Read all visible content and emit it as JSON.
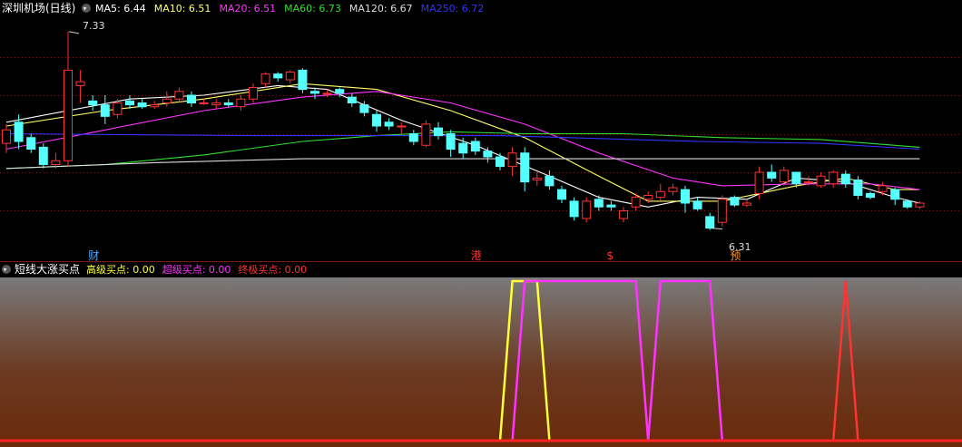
{
  "header": {
    "title": "深圳机场(日线)",
    "ma": [
      {
        "label": "MA5:",
        "value": "6.44",
        "color": "#ffffff"
      },
      {
        "label": "MA10:",
        "value": "6.51",
        "color": "#ffff66"
      },
      {
        "label": "MA20:",
        "value": "6.51",
        "color": "#ff33ff"
      },
      {
        "label": "MA60:",
        "value": "6.73",
        "color": "#33dd33"
      },
      {
        "label": "MA120:",
        "value": "6.67",
        "color": "#dddddd"
      },
      {
        "label": "MA250:",
        "value": "6.72",
        "color": "#3333ff"
      }
    ]
  },
  "indicator": {
    "title": "短线大涨买点",
    "items": [
      {
        "label": "高级买点:",
        "value": "0.00",
        "color": "#ffff33"
      },
      {
        "label": "超级买点:",
        "value": "0.00",
        "color": "#ff33ff"
      },
      {
        "label": "终极买点:",
        "value": "0.00",
        "color": "#ff3333"
      }
    ]
  },
  "annotations": {
    "high": "7.33",
    "low": "6.31",
    "markers": [
      "财",
      "港",
      "$",
      "预"
    ]
  },
  "colors": {
    "up": "#ff3333",
    "down": "#54ffff",
    "background": "#000000",
    "grid": "#7a1a1a"
  },
  "chart_data": {
    "type": "candlestick",
    "ylim": [
      6.2,
      7.4
    ],
    "candles": [
      [
        6.75,
        6.82,
        6.7,
        6.85
      ],
      [
        6.86,
        6.76,
        6.72,
        6.9
      ],
      [
        6.78,
        6.72,
        6.7,
        6.8
      ],
      [
        6.73,
        6.64,
        6.62,
        6.75
      ],
      [
        6.64,
        6.66,
        6.62,
        6.7
      ],
      [
        6.66,
        7.13,
        6.63,
        7.33
      ],
      [
        7.05,
        7.07,
        6.96,
        7.13
      ],
      [
        6.97,
        6.95,
        6.92,
        7.0
      ],
      [
        6.95,
        6.89,
        6.85,
        7.0
      ],
      [
        6.9,
        6.96,
        6.88,
        6.98
      ],
      [
        6.97,
        6.95,
        6.93,
        7.0
      ],
      [
        6.96,
        6.94,
        6.93,
        6.98
      ],
      [
        6.94,
        6.95,
        6.93,
        6.97
      ],
      [
        6.96,
        6.98,
        6.94,
        7.02
      ],
      [
        6.98,
        7.02,
        6.96,
        7.04
      ],
      [
        7.0,
        6.96,
        6.94,
        7.02
      ],
      [
        6.96,
        6.96,
        6.95,
        6.98
      ],
      [
        6.95,
        6.96,
        6.93,
        6.98
      ],
      [
        6.96,
        6.95,
        6.94,
        6.98
      ],
      [
        6.94,
        6.98,
        6.92,
        7.0
      ],
      [
        6.98,
        7.04,
        6.96,
        7.06
      ],
      [
        7.06,
        7.11,
        7.04,
        7.12
      ],
      [
        7.11,
        7.09,
        7.07,
        7.12
      ],
      [
        7.08,
        7.12,
        7.06,
        7.13
      ],
      [
        7.13,
        7.03,
        7.01,
        7.14
      ],
      [
        7.02,
        7.01,
        6.98,
        7.04
      ],
      [
        7.01,
        7.01,
        6.99,
        7.03
      ],
      [
        7.03,
        7.01,
        6.99,
        7.04
      ],
      [
        6.99,
        6.96,
        6.94,
        7.01
      ],
      [
        6.95,
        6.91,
        6.89,
        6.97
      ],
      [
        6.9,
        6.84,
        6.81,
        6.92
      ],
      [
        6.86,
        6.84,
        6.82,
        6.88
      ],
      [
        6.84,
        6.84,
        6.8,
        6.86
      ],
      [
        6.8,
        6.76,
        6.74,
        6.82
      ],
      [
        6.74,
        6.85,
        6.73,
        6.87
      ],
      [
        6.83,
        6.79,
        6.77,
        6.86
      ],
      [
        6.8,
        6.72,
        6.68,
        6.82
      ],
      [
        6.75,
        6.7,
        6.67,
        6.78
      ],
      [
        6.76,
        6.71,
        6.69,
        6.78
      ],
      [
        6.71,
        6.68,
        6.65,
        6.73
      ],
      [
        6.68,
        6.63,
        6.61,
        6.7
      ],
      [
        6.63,
        6.7,
        6.58,
        6.73
      ],
      [
        6.7,
        6.55,
        6.5,
        6.73
      ],
      [
        6.56,
        6.57,
        6.53,
        6.6
      ],
      [
        6.58,
        6.53,
        6.51,
        6.61
      ],
      [
        6.51,
        6.46,
        6.44,
        6.53
      ],
      [
        6.45,
        6.37,
        6.35,
        6.47
      ],
      [
        6.36,
        6.45,
        6.34,
        6.47
      ],
      [
        6.46,
        6.42,
        6.4,
        6.48
      ],
      [
        6.43,
        6.42,
        6.4,
        6.45
      ],
      [
        6.36,
        6.4,
        6.34,
        6.42
      ],
      [
        6.42,
        6.47,
        6.4,
        6.49
      ],
      [
        6.46,
        6.48,
        6.44,
        6.5
      ],
      [
        6.47,
        6.5,
        6.45,
        6.54
      ],
      [
        6.5,
        6.52,
        6.48,
        6.54
      ],
      [
        6.51,
        6.44,
        6.39,
        6.53
      ],
      [
        6.45,
        6.41,
        6.4,
        6.47
      ],
      [
        6.37,
        6.31,
        6.3,
        6.39
      ],
      [
        6.34,
        6.46,
        6.32,
        6.48
      ],
      [
        6.47,
        6.43,
        6.42,
        6.48
      ],
      [
        6.43,
        6.44,
        6.42,
        6.46
      ],
      [
        6.49,
        6.6,
        6.46,
        6.63
      ],
      [
        6.6,
        6.57,
        6.55,
        6.64
      ],
      [
        6.55,
        6.61,
        6.53,
        6.63
      ],
      [
        6.6,
        6.54,
        6.52,
        6.6
      ],
      [
        6.55,
        6.55,
        6.53,
        6.58
      ],
      [
        6.53,
        6.58,
        6.52,
        6.6
      ],
      [
        6.54,
        6.6,
        6.52,
        6.61
      ],
      [
        6.59,
        6.54,
        6.52,
        6.61
      ],
      [
        6.56,
        6.48,
        6.46,
        6.58
      ],
      [
        6.49,
        6.47,
        6.46,
        6.5
      ],
      [
        6.5,
        6.53,
        6.48,
        6.55
      ],
      [
        6.51,
        6.46,
        6.43,
        6.52
      ],
      [
        6.45,
        6.42,
        6.41,
        6.46
      ],
      [
        6.42,
        6.44,
        6.41,
        6.45
      ]
    ],
    "series": [
      {
        "name": "MA5",
        "color": "#ffffff",
        "values": [
          [
            0,
            6.86
          ],
          [
            10,
            6.98
          ],
          [
            16,
            7.0
          ],
          [
            22,
            7.05
          ],
          [
            26,
            7.03
          ],
          [
            32,
            6.87
          ],
          [
            38,
            6.74
          ],
          [
            44,
            6.58
          ],
          [
            48,
            6.47
          ],
          [
            52,
            6.42
          ],
          [
            56,
            6.47
          ],
          [
            60,
            6.46
          ],
          [
            64,
            6.57
          ],
          [
            68,
            6.55
          ],
          [
            72,
            6.47
          ],
          [
            74,
            6.44
          ]
        ]
      },
      {
        "name": "MA10",
        "color": "#ffff66",
        "values": [
          [
            0,
            6.84
          ],
          [
            8,
            6.92
          ],
          [
            16,
            6.98
          ],
          [
            24,
            7.06
          ],
          [
            30,
            7.03
          ],
          [
            36,
            6.92
          ],
          [
            42,
            6.78
          ],
          [
            48,
            6.58
          ],
          [
            52,
            6.45
          ],
          [
            58,
            6.45
          ],
          [
            64,
            6.53
          ],
          [
            68,
            6.57
          ],
          [
            72,
            6.51
          ],
          [
            74,
            6.51
          ]
        ]
      },
      {
        "name": "MA20",
        "color": "#ff33ff",
        "values": [
          [
            0,
            6.72
          ],
          [
            8,
            6.82
          ],
          [
            16,
            6.92
          ],
          [
            24,
            6.99
          ],
          [
            30,
            7.02
          ],
          [
            36,
            6.96
          ],
          [
            42,
            6.85
          ],
          [
            48,
            6.7
          ],
          [
            54,
            6.57
          ],
          [
            58,
            6.53
          ],
          [
            64,
            6.54
          ],
          [
            70,
            6.54
          ],
          [
            74,
            6.51
          ]
        ]
      },
      {
        "name": "MA60",
        "color": "#33dd33",
        "values": [
          [
            0,
            6.62
          ],
          [
            8,
            6.64
          ],
          [
            16,
            6.69
          ],
          [
            24,
            6.76
          ],
          [
            30,
            6.79
          ],
          [
            36,
            6.81
          ],
          [
            42,
            6.8
          ],
          [
            50,
            6.8
          ],
          [
            58,
            6.78
          ],
          [
            66,
            6.77
          ],
          [
            74,
            6.73
          ]
        ]
      },
      {
        "name": "MA120",
        "color": "#dddddd",
        "values": [
          [
            0,
            6.62
          ],
          [
            12,
            6.65
          ],
          [
            24,
            6.67
          ],
          [
            40,
            6.67
          ],
          [
            56,
            6.67
          ],
          [
            74,
            6.67
          ]
        ]
      },
      {
        "name": "MA250",
        "color": "#3333ff",
        "values": [
          [
            0,
            6.8
          ],
          [
            20,
            6.79
          ],
          [
            40,
            6.79
          ],
          [
            56,
            6.76
          ],
          [
            66,
            6.75
          ],
          [
            74,
            6.72
          ]
        ]
      }
    ],
    "indicator_series": [
      {
        "name": "高级买点",
        "color": "#ffff33",
        "values": [
          [
            0,
            0
          ],
          [
            40,
            0
          ],
          [
            41,
            1
          ],
          [
            43,
            1
          ],
          [
            44,
            0
          ],
          [
            74,
            0
          ]
        ]
      },
      {
        "name": "超级买点",
        "color": "#ff33ff",
        "values": [
          [
            0,
            0
          ],
          [
            41,
            0
          ],
          [
            42,
            1
          ],
          [
            51,
            1
          ],
          [
            52,
            0
          ],
          [
            53,
            1
          ],
          [
            57,
            1
          ],
          [
            58,
            0
          ],
          [
            74,
            0
          ]
        ]
      },
      {
        "name": "终极买点",
        "color": "#ff3333",
        "values": [
          [
            0,
            0
          ],
          [
            67,
            0
          ],
          [
            68,
            1
          ],
          [
            69,
            0
          ],
          [
            74,
            0
          ]
        ]
      }
    ],
    "markers": [
      {
        "index": 7,
        "label": "财",
        "color": "#54aaff"
      },
      {
        "index": 38,
        "label": "港",
        "color": "#ff3333"
      },
      {
        "index": 49,
        "label": "$",
        "color": "#ff3333"
      },
      {
        "index": 59,
        "label": "预",
        "color": "#ff9933"
      }
    ]
  }
}
